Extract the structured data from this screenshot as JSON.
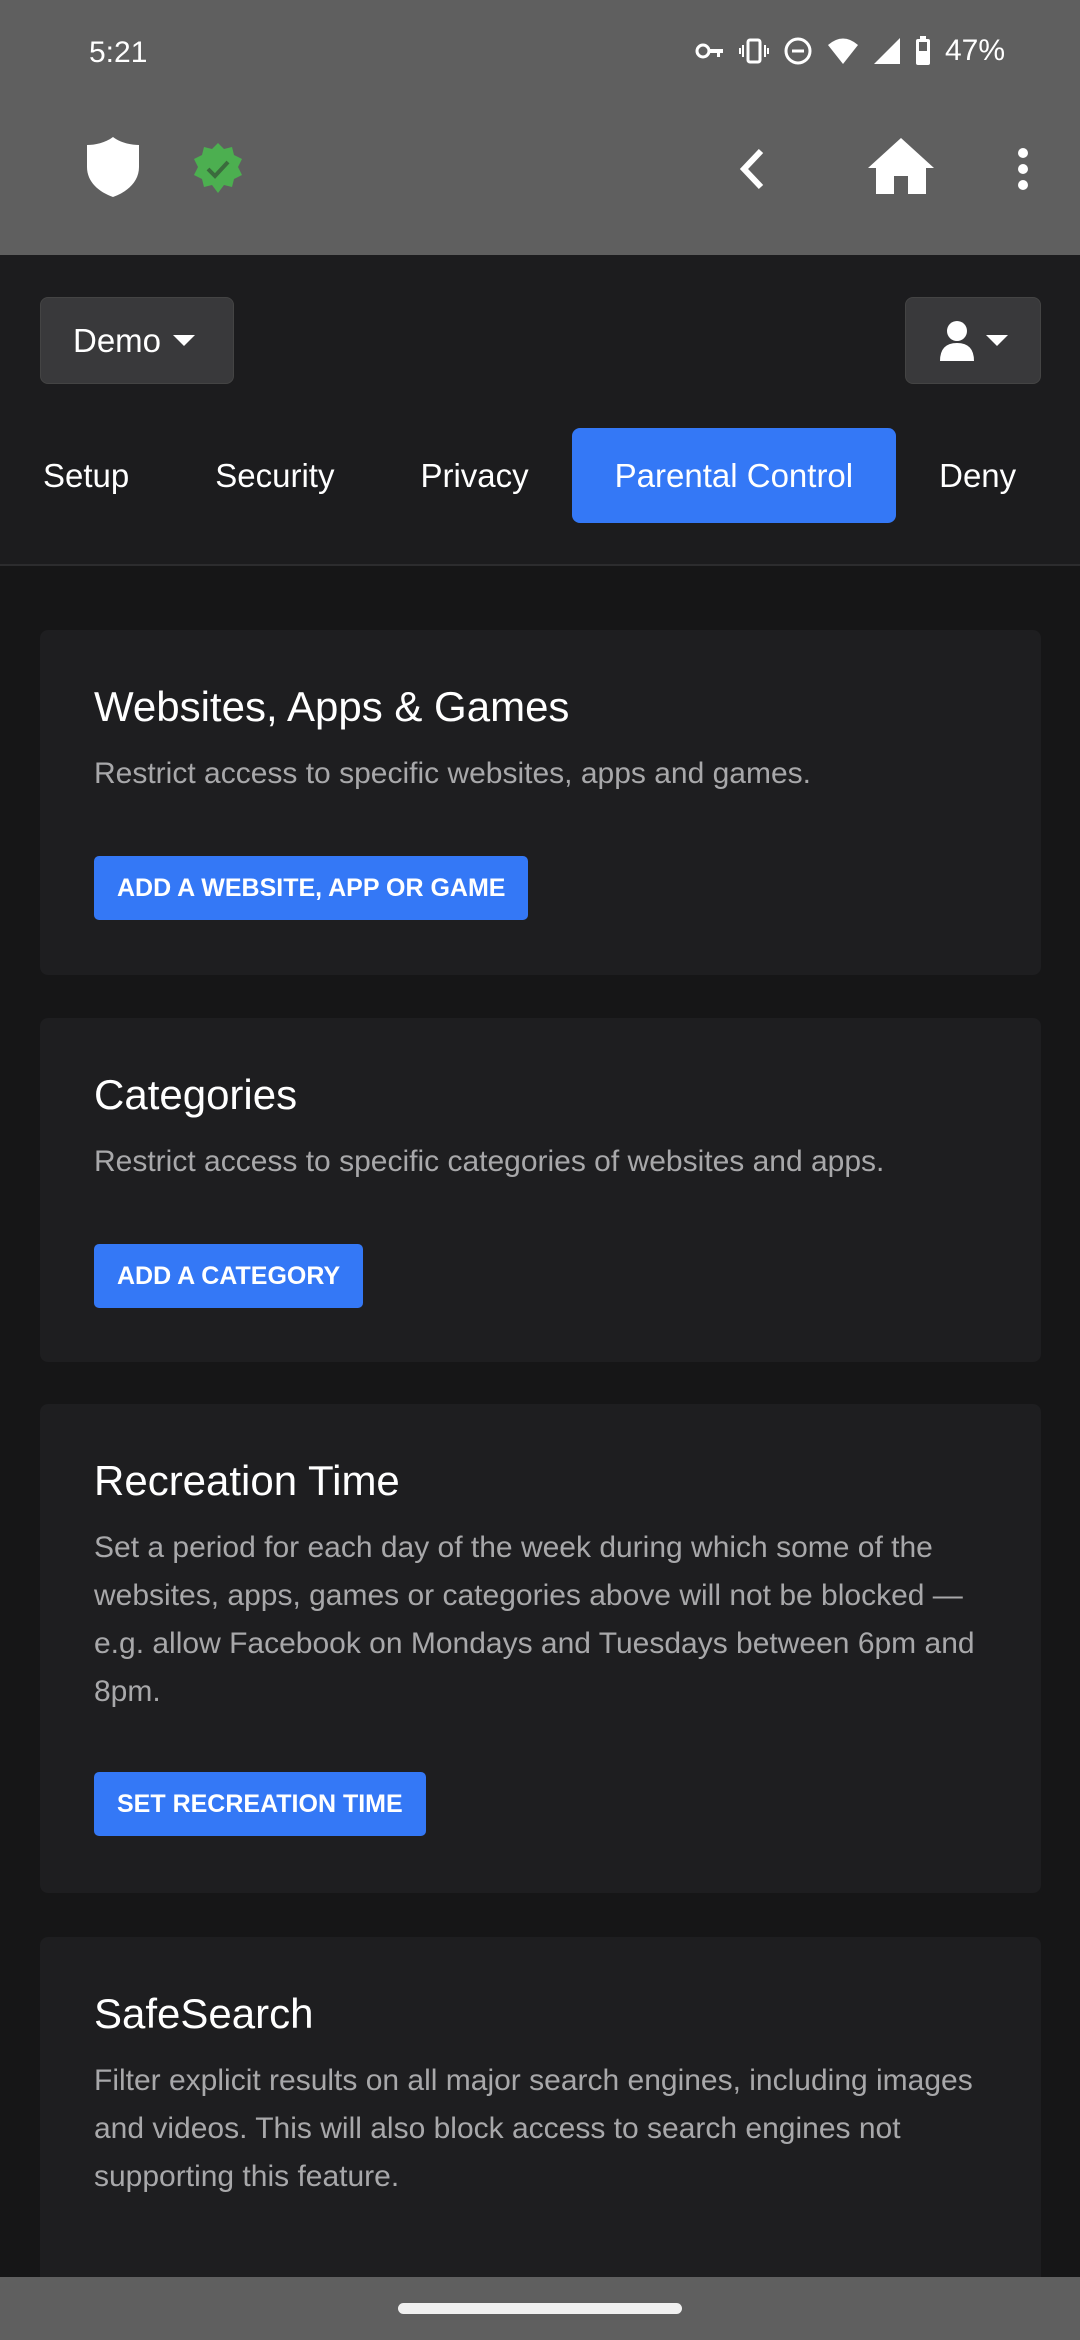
{
  "status_bar": {
    "time": "5:21",
    "battery": "47%",
    "icons": [
      "vpn-key-icon",
      "vibrate-icon",
      "dnd-icon",
      "wifi-icon",
      "signal-icon",
      "battery-icon"
    ]
  },
  "toolbar": {
    "icons": [
      "shield-icon",
      "verified-badge-icon",
      "back-icon",
      "home-icon",
      "more-vert-icon"
    ],
    "badge_color": "#4caf50"
  },
  "header": {
    "profile_select": "Demo",
    "tabs": [
      {
        "label": "Setup"
      },
      {
        "label": "Security"
      },
      {
        "label": "Privacy"
      },
      {
        "label": "Parental Control",
        "active": true
      },
      {
        "label": "Deny"
      }
    ],
    "accent": "#3478f6"
  },
  "cards": [
    {
      "title": "Websites, Apps & Games",
      "description": "Restrict access to specific websites, apps and games.",
      "button": "ADD A WEBSITE, APP OR GAME"
    },
    {
      "title": "Categories",
      "description": "Restrict access to specific categories of websites and apps.",
      "button": "ADD A CATEGORY"
    },
    {
      "title": "Recreation Time",
      "description": "Set a period for each day of the week during which some of the websites, apps, games or categories above will not be blocked — e.g. allow Facebook on Mondays and Tuesdays between 6pm and 8pm.",
      "button": "SET RECREATION TIME"
    },
    {
      "title": "SafeSearch",
      "description": "Filter explicit results on all major search engines, including images and videos. This will also block access to search engines not supporting this feature."
    }
  ]
}
